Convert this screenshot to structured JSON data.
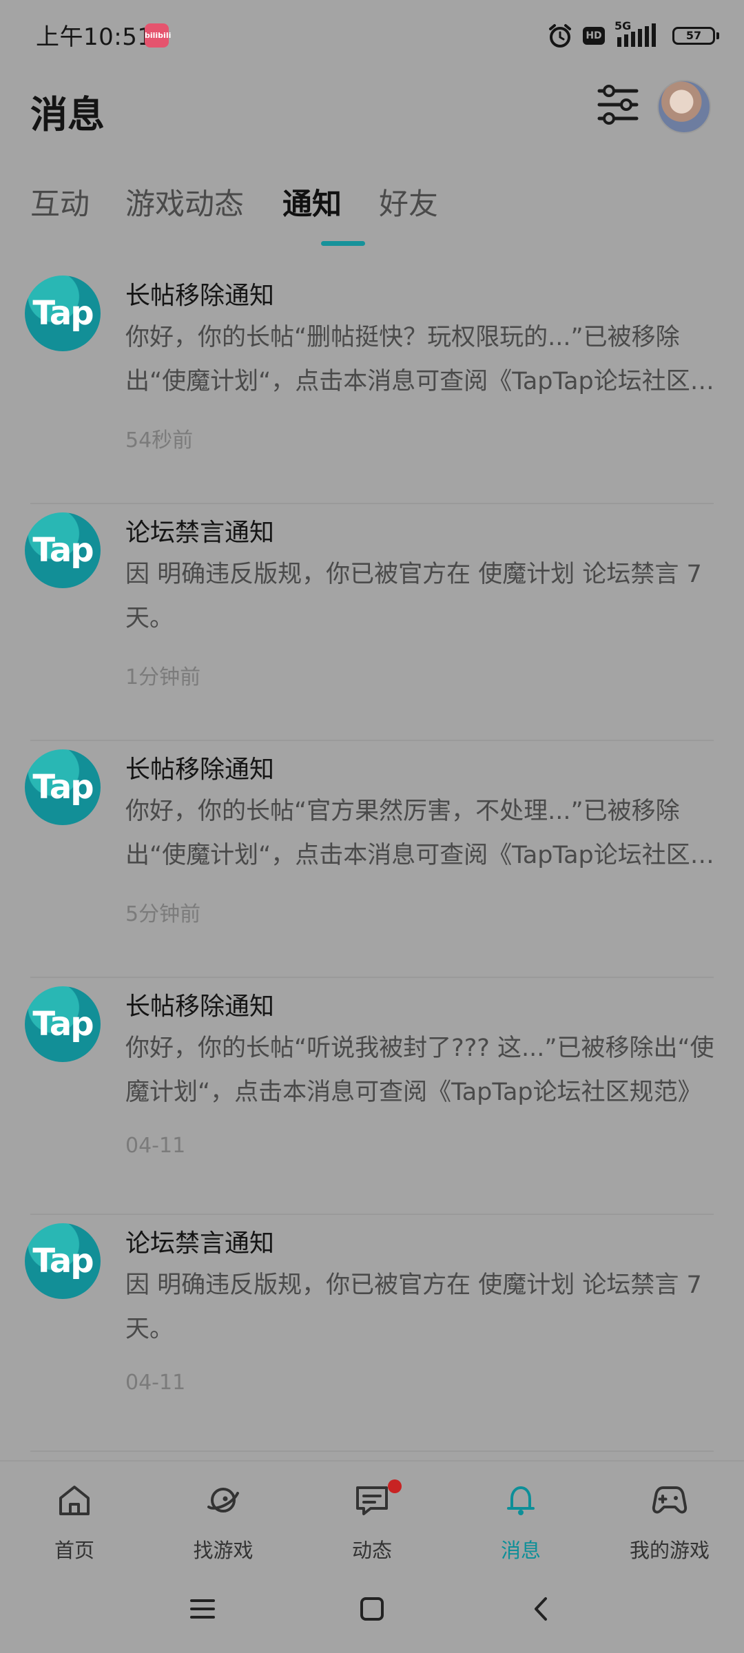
{
  "status_bar": {
    "time": "上午10:51",
    "app_badge": "bilibili",
    "network": "5G",
    "hd": "HD",
    "battery": "57"
  },
  "header": {
    "title": "消息"
  },
  "tabs": [
    {
      "label": "互动"
    },
    {
      "label": "游戏动态"
    },
    {
      "label": "通知"
    },
    {
      "label": "好友"
    }
  ],
  "notifications": [
    {
      "title": "长帖移除通知",
      "body": "你好，你的长帖“删帖挺快？玩权限玩的...”已被移除出“使魔计划“，点击本消息可查阅《TapTap论坛社区规范》",
      "time": "54秒前",
      "avatar_text": "Tap"
    },
    {
      "title": "论坛禁言通知",
      "body": "因 明确违反版规，你已被官方在 使魔计划 论坛禁言 7 天。",
      "time": "1分钟前",
      "avatar_text": "Tap"
    },
    {
      "title": "长帖移除通知",
      "body": "你好，你的长帖“官方果然厉害，不处理...”已被移除出“使魔计划“，点击本消息可查阅《TapTap论坛社区规范》",
      "time": "5分钟前",
      "avatar_text": "Tap"
    },
    {
      "title": "长帖移除通知",
      "body": "你好，你的长帖“听说我被封了??? 这...”已被移除出“使魔计划“，点击本消息可查阅《TapTap论坛社区规范》",
      "time": "04-11",
      "avatar_text": "Tap"
    },
    {
      "title": "论坛禁言通知",
      "body": "因 明确违反版规，你已被官方在 使魔计划 论坛禁言 7 天。",
      "time": "04-11",
      "avatar_text": "Tap"
    }
  ],
  "bottom_nav": [
    {
      "label": "首页",
      "icon": "home-icon"
    },
    {
      "label": "找游戏",
      "icon": "planet-icon"
    },
    {
      "label": "动态",
      "icon": "chat-icon"
    },
    {
      "label": "消息",
      "icon": "bell-icon"
    },
    {
      "label": "我的游戏",
      "icon": "gamepad-icon"
    }
  ],
  "colors": {
    "accent": "#0d8f98",
    "badge_red": "#c82323"
  }
}
